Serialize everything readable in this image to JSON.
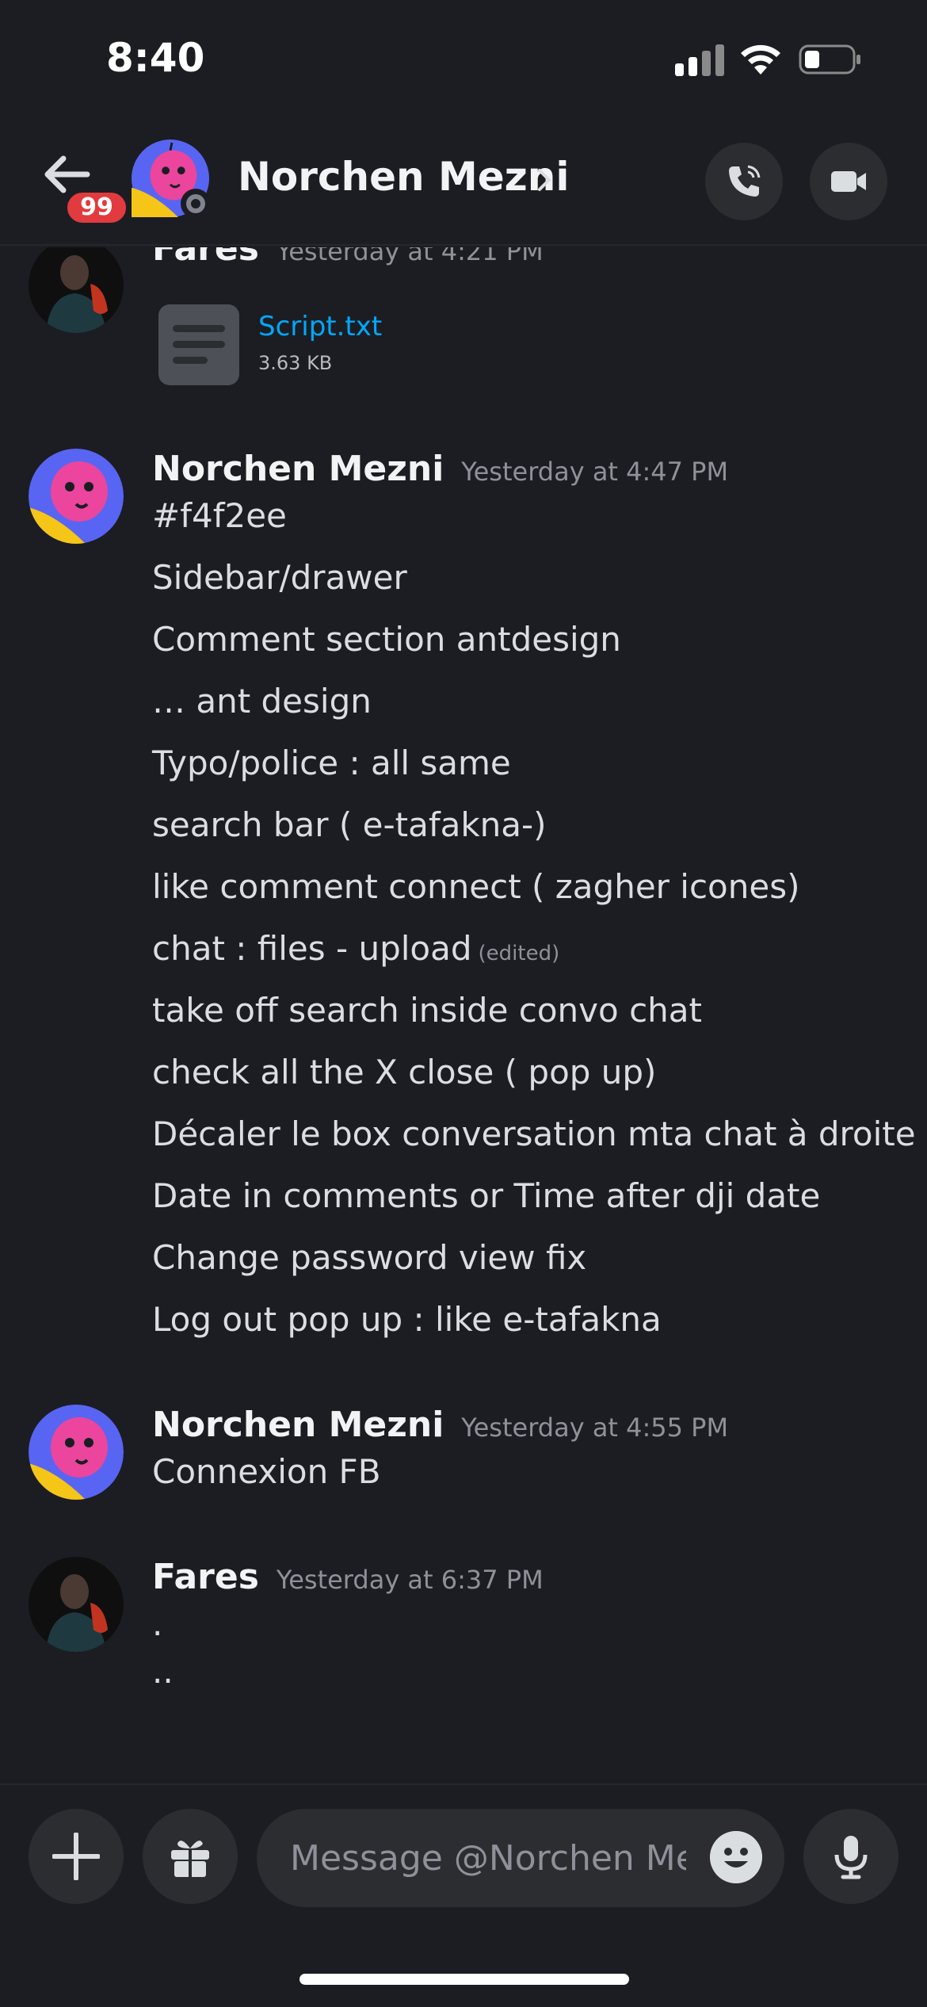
{
  "status_bar": {
    "time": "8:40"
  },
  "header": {
    "unread_badge": "99",
    "title": "Norchen Mezni"
  },
  "messages": [
    {
      "author": "Fares",
      "timestamp": "Yesterday at 4:21 PM",
      "attachment": {
        "name": "Script.txt",
        "size": "3.63 KB"
      }
    },
    {
      "author": "Norchen Mezni",
      "timestamp": "Yesterday at 4:47 PM",
      "lines": [
        "#f4f2ee",
        "Sidebar/drawer",
        "Comment section antdesign",
        "… ant design",
        "Typo/police : all same",
        "search bar ( e-tafakna-)",
        "like comment connect ( zagher icones)",
        "chat : files - upload",
        "take off search inside convo chat",
        "check all the X close ( pop up)",
        "Décaler le box conversation mta chat à droite",
        "Date in comments or Time after dji date",
        "Change password view fix",
        "Log out pop up : like e-tafakna"
      ],
      "edited_label": "(edited)"
    },
    {
      "author": "Norchen Mezni",
      "timestamp": "Yesterday at 4:55 PM",
      "lines": [
        "Connexion FB"
      ]
    },
    {
      "author": "Fares",
      "timestamp": "Yesterday at 6:37 PM",
      "lines": [
        ".",
        ".."
      ]
    }
  ],
  "composer": {
    "placeholder": "Message @Norchen Me…"
  },
  "colors": {
    "background": "#1c1d22",
    "surface": "#2b2d31",
    "link": "#00a8fc",
    "badge": "#e13b3f"
  },
  "icons": [
    "back-arrow-icon",
    "phone-icon",
    "video-icon",
    "chevron-right-icon",
    "file-icon",
    "plus-icon",
    "gift-icon",
    "emoji-icon",
    "microphone-icon"
  ]
}
